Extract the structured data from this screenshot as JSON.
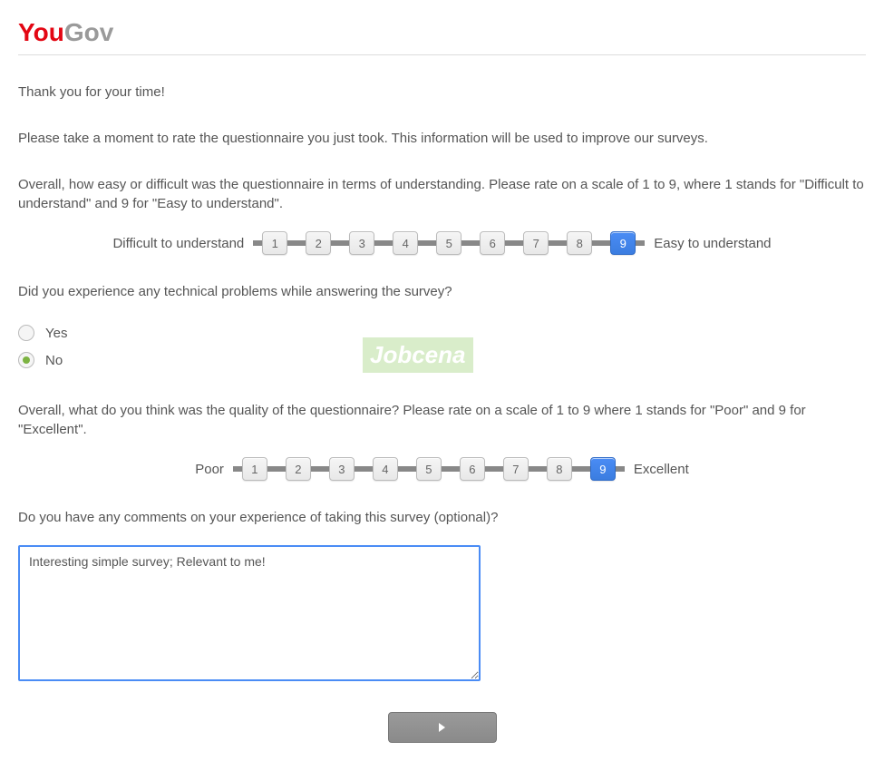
{
  "logo": {
    "part1": "You",
    "part2": "Gov"
  },
  "intro": {
    "thanks": "Thank you for your time!",
    "prompt": "Please take a moment to rate the questionnaire you just took. This information will be used to improve our surveys."
  },
  "q_understanding": {
    "text": "Overall, how easy or difficult was the questionnaire in terms of understanding. Please rate on a scale of 1 to 9, where 1 stands for \"Difficult to understand\" and 9 for \"Easy to understand\".",
    "left": "Difficult to understand",
    "right": "Easy to understand",
    "options": [
      "1",
      "2",
      "3",
      "4",
      "5",
      "6",
      "7",
      "8",
      "9"
    ],
    "selected": "9"
  },
  "q_technical": {
    "text": "Did you experience any technical problems while answering the survey?",
    "options": [
      {
        "label": "Yes",
        "selected": false
      },
      {
        "label": "No",
        "selected": true
      }
    ]
  },
  "q_quality": {
    "text": "Overall, what do you think was the quality of the questionnaire? Please rate on a scale of 1 to 9 where 1 stands for \"Poor\" and 9 for \"Excellent\".",
    "left": "Poor",
    "right": "Excellent",
    "options": [
      "1",
      "2",
      "3",
      "4",
      "5",
      "6",
      "7",
      "8",
      "9"
    ],
    "selected": "9"
  },
  "q_comments": {
    "text": "Do you have any comments on your experience of taking this survey (optional)?",
    "value": "Interesting simple survey; Relevant to me!"
  },
  "watermark": "Jobcena"
}
